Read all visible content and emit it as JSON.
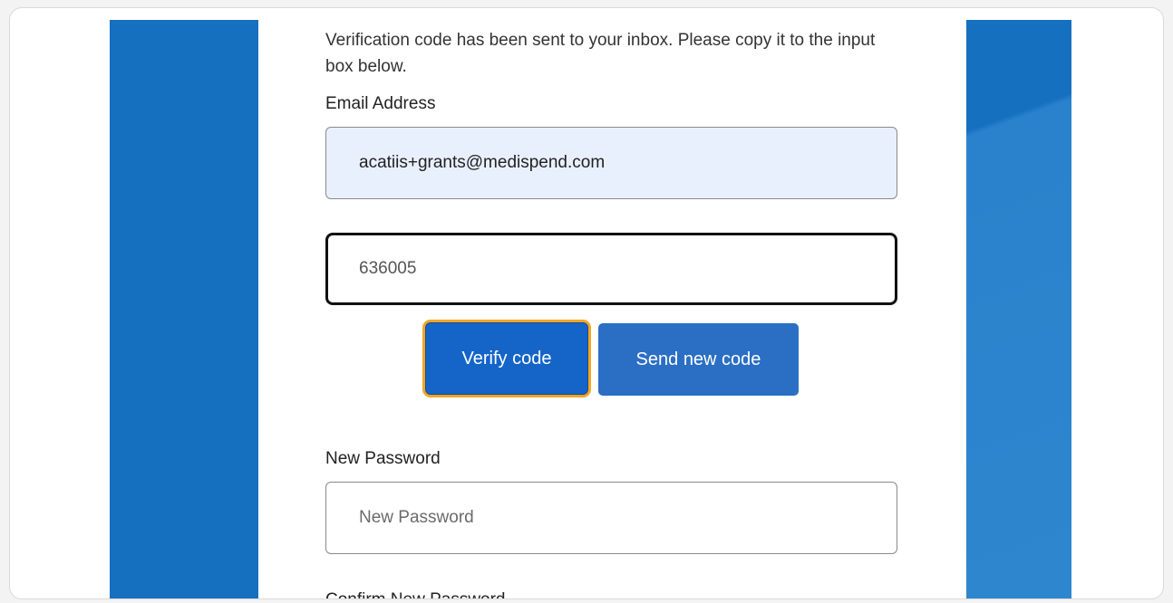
{
  "form": {
    "intro_text": "Verification code has been sent to your inbox. Please copy it to the input box below.",
    "email_label": "Email Address",
    "email_value": "acatiis+grants@medispend.com",
    "code_value": "636005",
    "verify_button": "Verify code",
    "send_new_button": "Send new code",
    "new_password_label": "New Password",
    "new_password_placeholder": "New Password",
    "confirm_password_label": "Confirm New Password"
  },
  "colors": {
    "brand_blue": "#1570c0",
    "verify_button": "#1565c8",
    "send_button": "#2b6fc4",
    "focus_ring": "#f5a623",
    "email_autofill_bg": "#e8f0fe"
  }
}
